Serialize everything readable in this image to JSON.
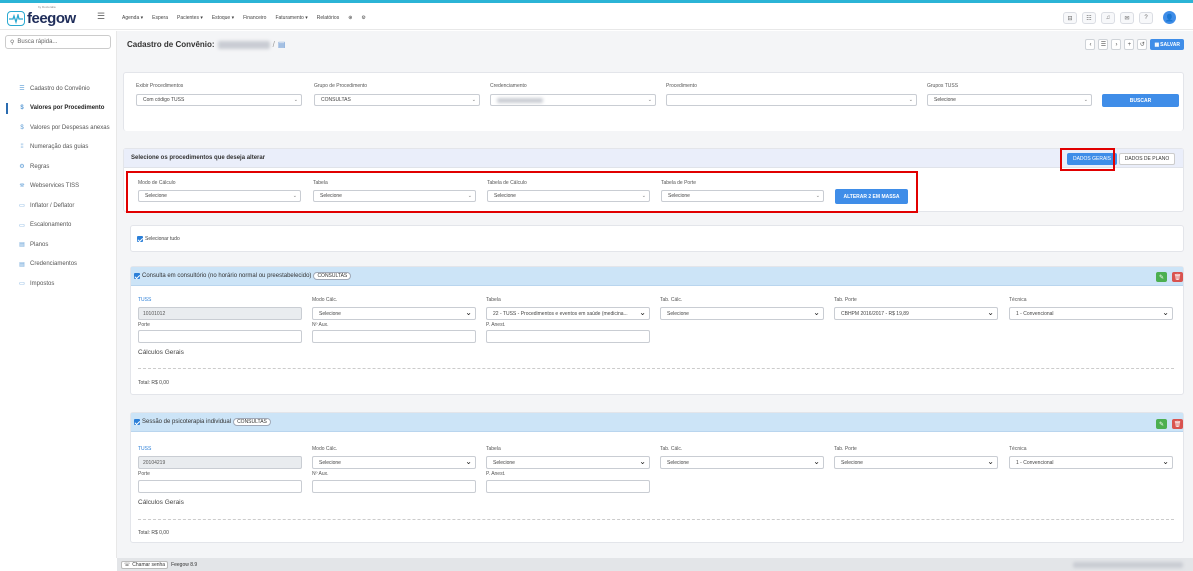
{
  "app": {
    "logo_text": "feegow",
    "logo_sub": "by Doctoralia",
    "menu": [
      "Agenda ▾",
      "Espera",
      "Pacientes ▾",
      "Estoque ▾",
      "Financeiro",
      "Faturamento ▾",
      "Relatórios",
      "⊕",
      "⚙"
    ],
    "avatar_initial": "👤"
  },
  "sidebar": {
    "search_placeholder": "Busca rápida...",
    "items": [
      {
        "icon": "☰",
        "label": "Cadastro do Convênio"
      },
      {
        "icon": "$",
        "label": "Valores por Procedimento"
      },
      {
        "icon": "$",
        "label": "Valores por Despesas anexas"
      },
      {
        "icon": "⁞⁞",
        "label": "Numeração das guias"
      },
      {
        "icon": "⚙",
        "label": "Regras"
      },
      {
        "icon": "⛯",
        "label": "Webservices TISS"
      },
      {
        "icon": "▭",
        "label": "Inflator / Deflator"
      },
      {
        "icon": "▭",
        "label": "Escalonamento"
      },
      {
        "icon": "▤",
        "label": "Planos"
      },
      {
        "icon": "▤",
        "label": "Credenciamentos"
      },
      {
        "icon": "▭",
        "label": "Impostos"
      }
    ]
  },
  "header": {
    "title": "Cadastro de Convênio:",
    "save_label": "SALVAR"
  },
  "filters": {
    "exibir_label": "Exibir Procedimentos",
    "exibir_value": "Com código TUSS",
    "grupo_label": "Grupo de Procedimento",
    "grupo_value": "CONSULTAS",
    "credenciamento_label": "Credenciamento",
    "procedimento_label": "Procedimento",
    "procedimento_value": "",
    "grupos_tuss_label": "Grupos TUSS",
    "grupos_tuss_value": "Selecione",
    "buscar_label": "BUSCAR"
  },
  "bulk": {
    "heading": "Selecione os procedimentos que deseja alterar",
    "tab_general": "DADOS GERAIS",
    "tab_plan": "DADOS DE PLANO",
    "modo_label": "Modo de Cálculo",
    "modo_value": "Selecione",
    "tabela_label": "Tabela",
    "tabela_value": "Selecione",
    "tabela_calc_label": "Tabela de Cálculo",
    "tabela_calc_value": "Selecione",
    "tabela_porte_label": "Tabela de Porte",
    "tabela_porte_value": "Selecione",
    "alterar_label": "ALTERAR 2 EM MASSA"
  },
  "select_all_label": "Selecionar tudo",
  "procedures": [
    {
      "name": "Consulta em consultório (no horário normal ou preestabelecido)",
      "group": "CONSULTAS",
      "tuss_label": "TUSS",
      "tuss_value": "10101012",
      "modo_label": "Modo Cálc.",
      "modo_value": "Selecione",
      "tabela_label": "Tabela",
      "tabela_value": "22 - TUSS - Procedimentos e eventos em saúde (medicina...",
      "tab_calc_label": "Tab. Cálc.",
      "tab_calc_value": "Selecione",
      "tab_porte_label": "Tab. Porte",
      "tab_porte_value": "CBHPM 2016/2017 - R$ 19,89",
      "tecnica_label": "Técnica",
      "tecnica_value": "1 - Convencional",
      "porte_label": "Porte",
      "aux_label": "Nº Aux.",
      "aneste_label": "P. Anest.",
      "calc_title": "Cálculos Gerais",
      "total": "Total: R$ 0,00"
    },
    {
      "name": "Sessão de psicoterapia individual",
      "group": "CONSULTAS",
      "tuss_label": "TUSS",
      "tuss_value": "20104219",
      "modo_label": "Modo Cálc.",
      "modo_value": "Selecione",
      "tabela_label": "Tabela",
      "tabela_value": "Selecione",
      "tab_calc_label": "Tab. Cálc.",
      "tab_calc_value": "Selecione",
      "tab_porte_label": "Tab. Porte",
      "tab_porte_value": "Selecione",
      "tecnica_label": "Técnica",
      "tecnica_value": "1 - Convencional",
      "porte_label": "Porte",
      "aux_label": "Nº Aux.",
      "aneste_label": "P. Anest.",
      "calc_title": "Cálculos Gerais",
      "total": "Total: R$ 0,00"
    }
  ],
  "footer": {
    "chamar_label": "Chamar senha",
    "version": "Feegow 8.9"
  }
}
